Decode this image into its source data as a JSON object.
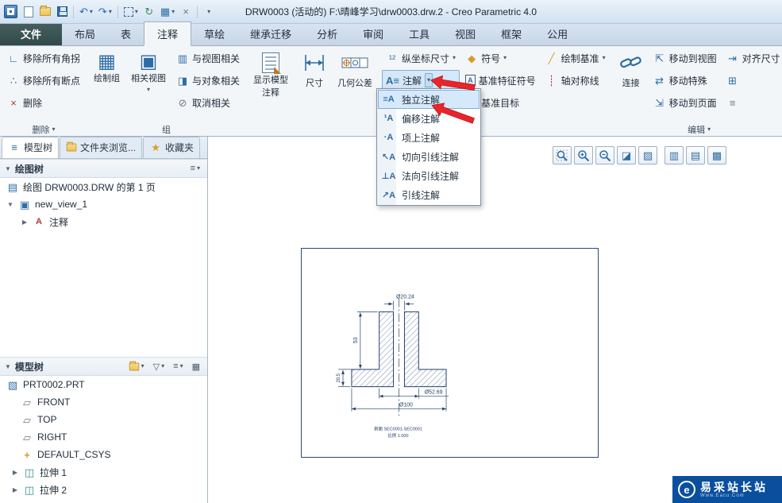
{
  "title_bar": {
    "title": "DRW0003 (活动的) F:\\晴峰学习\\drw0003.drw.2 - Creo Parametric 4.0"
  },
  "ribbon_tabs": {
    "file": "文件",
    "items": [
      "布局",
      "表",
      "注释",
      "草绘",
      "继承迁移",
      "分析",
      "审阅",
      "工具",
      "视图",
      "框架",
      "公用"
    ]
  },
  "ribbon": {
    "remove_all_jogs": "移除所有角拐",
    "remove_all_breaks": "移除所有断点",
    "delete": "删除",
    "delete_footer": "删除",
    "sketch_group": "绘制组",
    "related_view": "相关视图",
    "group_footer": "组",
    "relate_to_view": "与视图相关",
    "relate_to_object": "与对象相关",
    "unrelate": "取消相关",
    "show_model_annotations_line1": "显示模型",
    "show_model_annotations_line2": "注释",
    "dimension": "尺寸",
    "geometric_tolerance": "几何公差",
    "ordinate_dimension": "纵坐标尺寸",
    "note": "注解",
    "symbol": "符号",
    "datum_feature_symbol": "基准特征符号",
    "datum_target": "基准目标",
    "draft_datum": "绘制基准",
    "axis_symmetry_line": "轴对称线",
    "attach": "连接",
    "move_to_view": "移动到视图",
    "move_special": "移动特殊",
    "move_to_sheet": "移动到页面",
    "align_dimensions": "对齐尺寸",
    "edit_footer": "编辑"
  },
  "note_dropdown": {
    "items": [
      {
        "label": "独立注解",
        "icon": "≡A"
      },
      {
        "label": "偏移注解",
        "icon": "¹A"
      },
      {
        "label": "项上注解",
        "icon": "·A"
      },
      {
        "label": "切向引线注解",
        "icon": "↖A"
      },
      {
        "label": "法向引线注解",
        "icon": "⊥A"
      },
      {
        "label": "引线注解",
        "icon": "↗A"
      }
    ]
  },
  "left_panel": {
    "tabs": [
      {
        "label": "模型树"
      },
      {
        "label": "文件夹浏览..."
      },
      {
        "label": "收藏夹"
      }
    ],
    "drawing_tree": {
      "header": "绘图树",
      "items": [
        {
          "label": "绘图 DRW0003.DRW 的第 1 页"
        },
        {
          "label": "new_view_1"
        },
        {
          "label": "注释"
        }
      ]
    },
    "model_tree": {
      "header": "模型树",
      "items": [
        {
          "label": "PRT0002.PRT"
        },
        {
          "label": "FRONT"
        },
        {
          "label": "TOP"
        },
        {
          "label": "RIGHT"
        },
        {
          "label": "DEFAULT_CSYS"
        },
        {
          "label": "拉伸 1"
        },
        {
          "label": "拉伸 2"
        }
      ]
    }
  },
  "canvas": {
    "drawing": {
      "dim_top_diameter": "Ø20.24",
      "dim_height": "53",
      "dim_flange_height": "20.5",
      "dim_mid_diameter": "Ø52.69",
      "dim_outer_diameter": "Ø100",
      "caption_line1": "剖面 SEC0001-SEC0001",
      "caption_line2": "比例 1.000"
    }
  },
  "watermark": {
    "name": "易采站长站",
    "url": "Www.Eacu.Com",
    "logo": "e"
  },
  "icons": {
    "caret_down": "▾",
    "tree_open": "▼",
    "tree_closed": "▶",
    "undo": "↶",
    "redo": "↷",
    "regenerate": "↻",
    "windows": "▦",
    "close": "×",
    "remove_jog": "∟",
    "remove_break": "∴",
    "delete_x": "×",
    "sketch_group": "▦",
    "related_view": "▣",
    "rel_view": "▥",
    "rel_obj": "◨",
    "unrel": "⊘",
    "ordinate": "¹²",
    "note": "A≡",
    "symbol": "◆",
    "datum_feature": "A",
    "datum_target": "◎",
    "draft_datum": "╱",
    "axis_line": "┊",
    "move_view": "⇱",
    "move_special": "⇄",
    "move_sheet": "⇲",
    "align_dim": "⇥",
    "clip1": "⊞",
    "clip2": "≡",
    "panel_tree": "≡",
    "star": "★",
    "list": "≡",
    "funnel": "▽",
    "grid": "▦",
    "repaint": "◪",
    "shade": "▨",
    "layers": "▥",
    "display": "▩",
    "sheet_item": "▤",
    "view_item": "▣",
    "annotation_item": "A",
    "part": "▧",
    "datum_plane": "▱",
    "csys": "+",
    "extrude": "◫"
  }
}
